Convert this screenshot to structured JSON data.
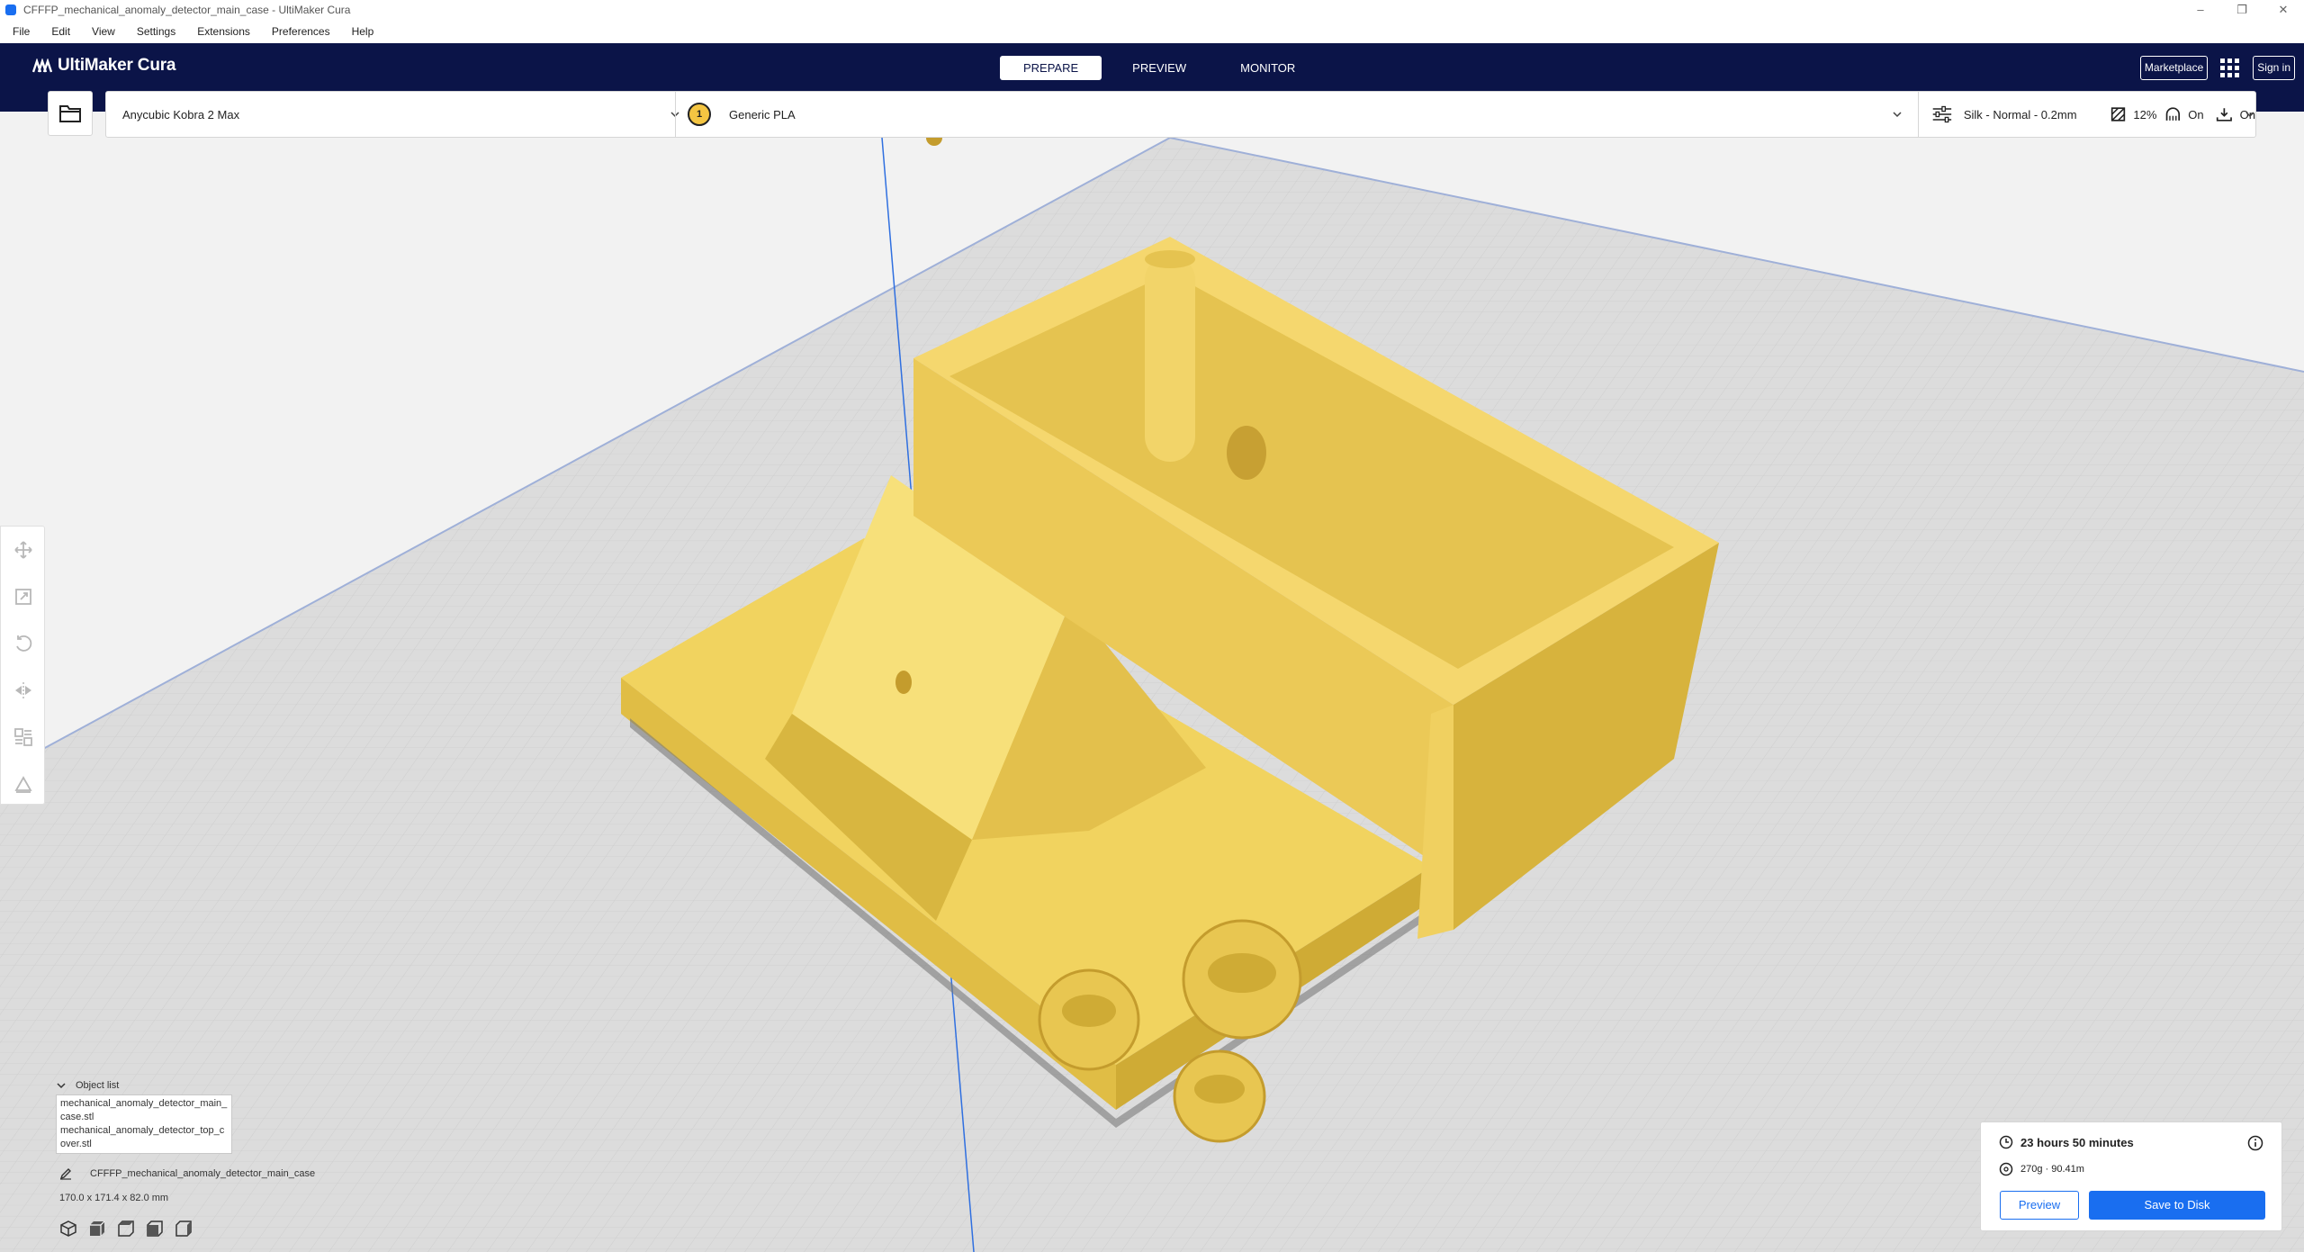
{
  "window": {
    "title": "CFFFP_mechanical_anomaly_detector_main_case - UltiMaker Cura",
    "controls": [
      "–",
      "❐",
      "✕"
    ]
  },
  "menu": [
    "File",
    "Edit",
    "View",
    "Settings",
    "Extensions",
    "Preferences",
    "Help"
  ],
  "header": {
    "logo": "UltiMaker Cura",
    "stages": [
      "PREPARE",
      "PREVIEW",
      "MONITOR"
    ],
    "active_stage": "PREPARE",
    "marketplace": "Marketplace",
    "signin": "Sign in"
  },
  "toolbar": {
    "printer": "Anycubic Kobra 2 Max",
    "extruder_number": "1",
    "material": "Generic PLA",
    "profile": "Silk - Normal - 0.2mm",
    "infill": "12%",
    "support": "On",
    "adhesion": "On"
  },
  "tools": [
    "move-icon",
    "scale-icon",
    "rotate-icon",
    "mirror-icon",
    "per-model-settings-icon",
    "support-blocker-icon"
  ],
  "object_list": {
    "header": "Object list",
    "items": [
      "mechanical_anomaly_detector_main_case.stl",
      "mechanical_anomaly_detector_top_cover.stl"
    ],
    "job_name": "CFFFP_mechanical_anomaly_detector_main_case",
    "dimensions": "170.0 x 171.4 x 82.0 mm"
  },
  "print_summary": {
    "time": "23 hours 50 minutes",
    "material": "270g · 90.41m",
    "preview_label": "Preview",
    "save_label": "Save to Disk"
  },
  "colors": {
    "header_bg": "#0b1448",
    "accent": "#196ef0",
    "model": "#f5d76e"
  }
}
